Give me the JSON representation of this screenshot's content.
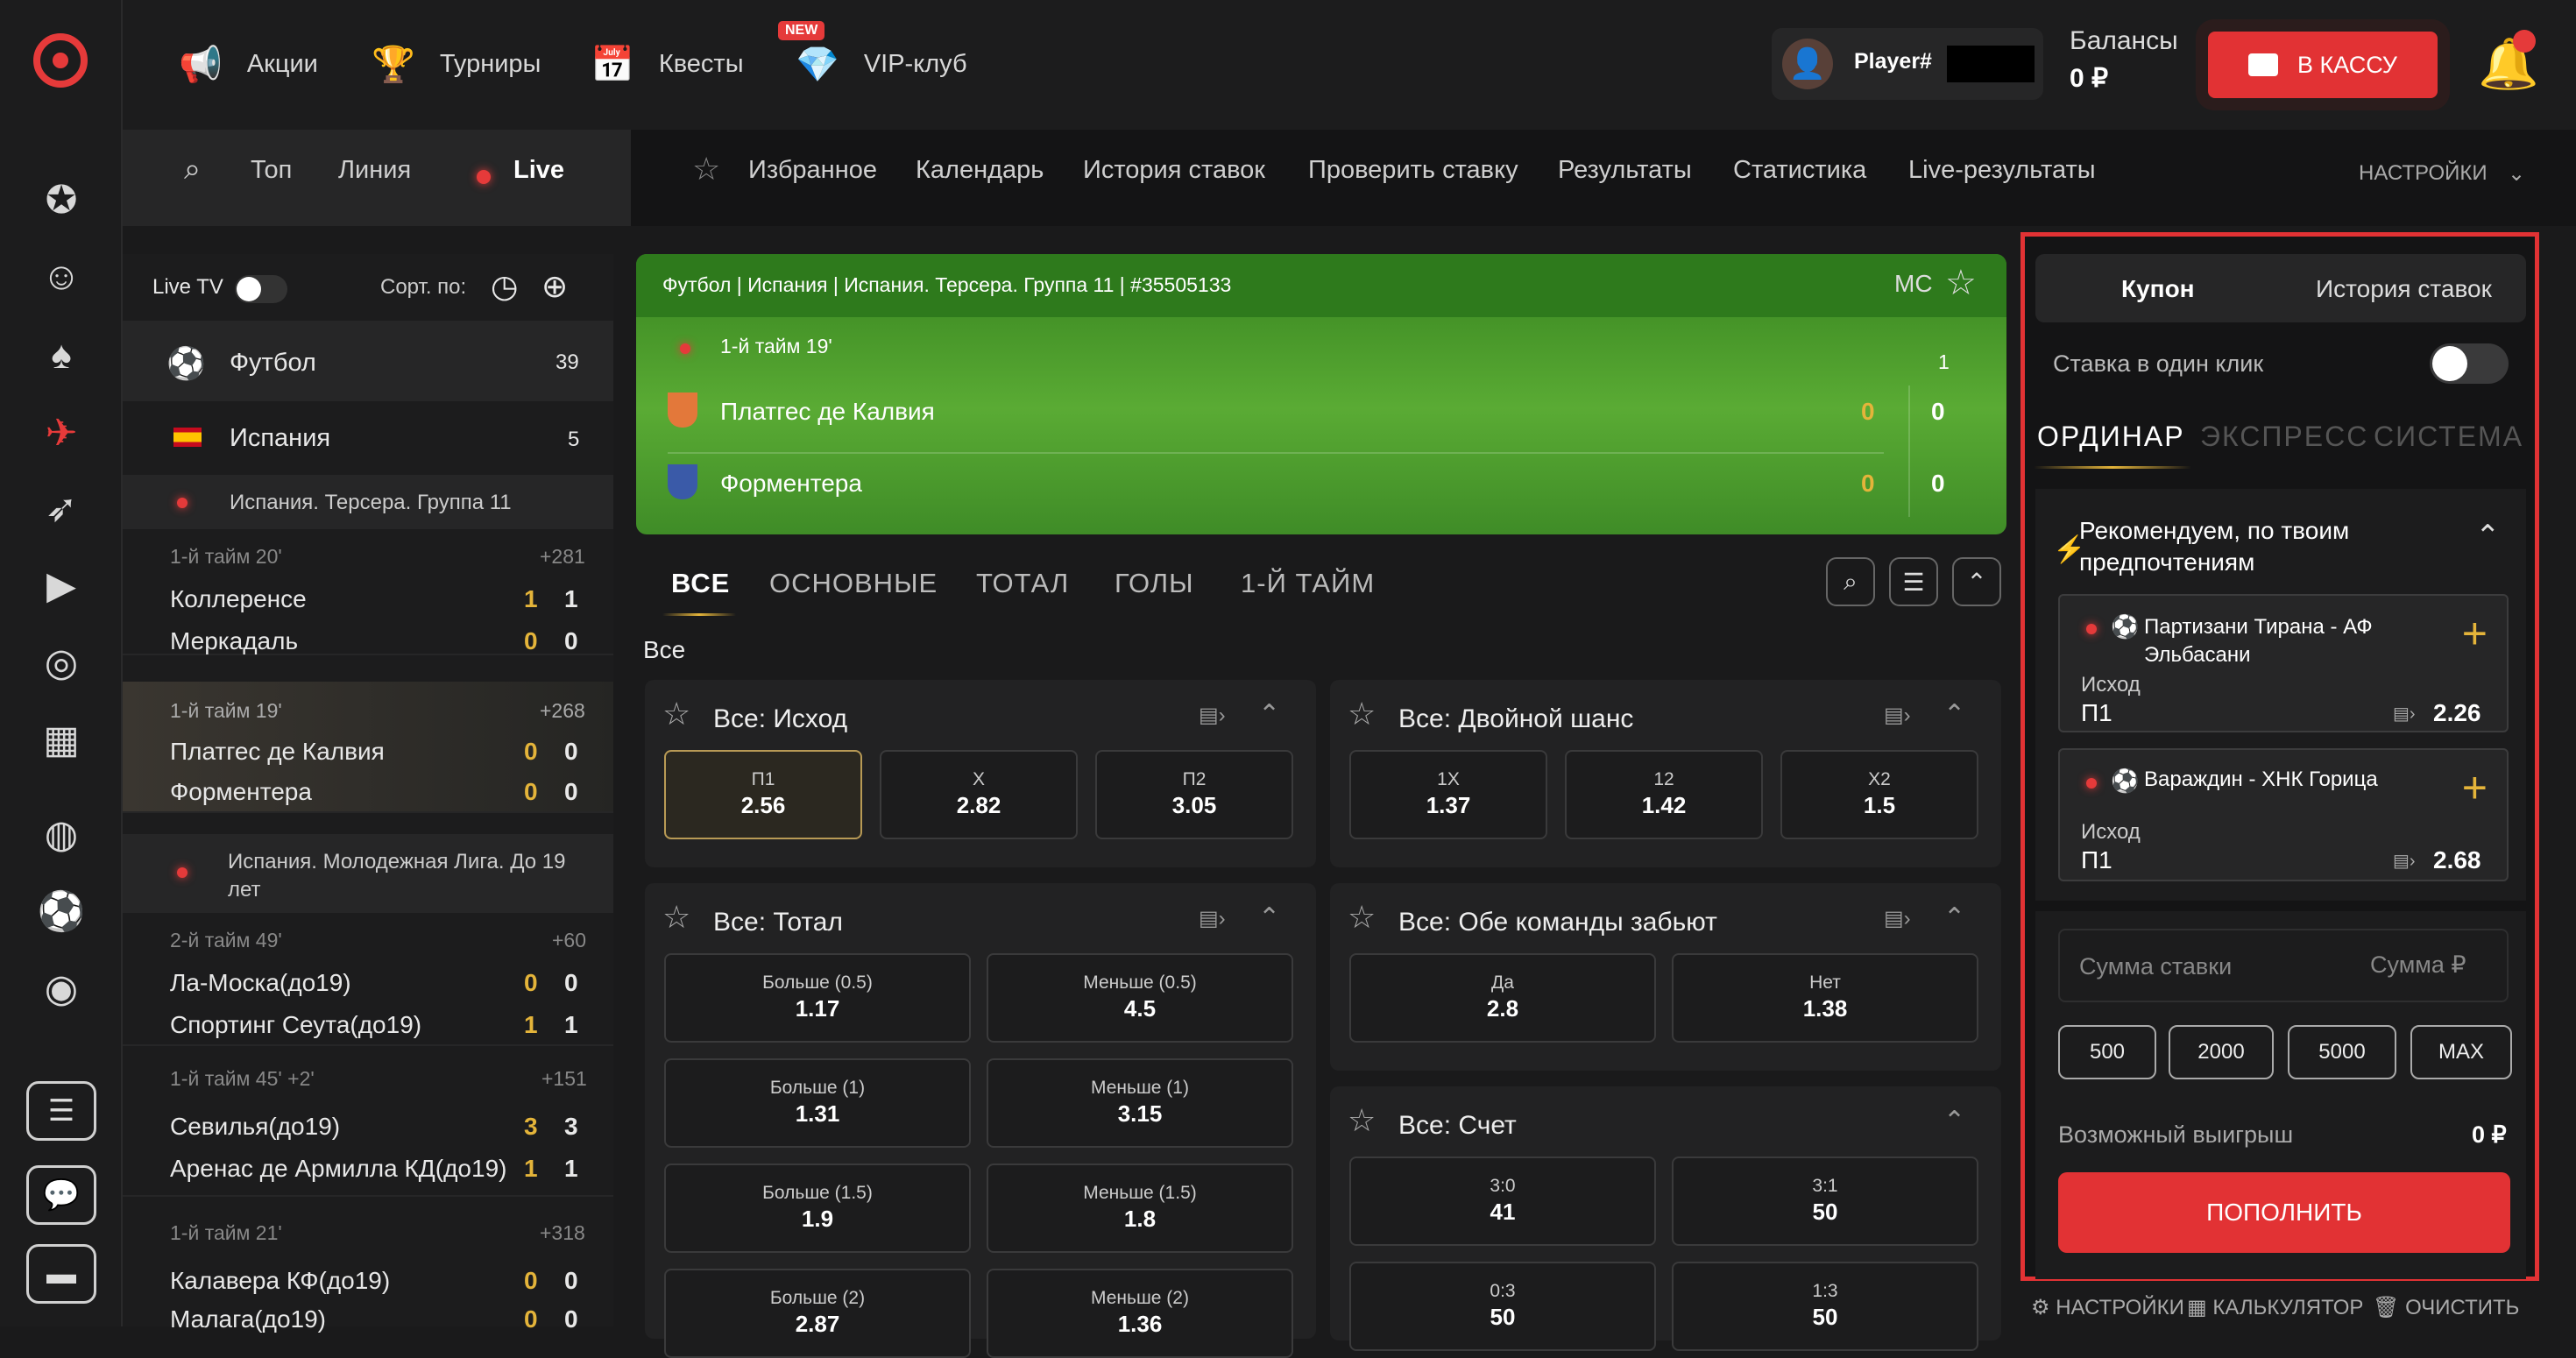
{
  "topnav": {
    "promos": "Акции",
    "tournaments": "Турниры",
    "quests": "Квесты",
    "quests_badge": "NEW",
    "vip": "VIP-клуб"
  },
  "user": {
    "name": "Player#",
    "balance_label": "Балансы",
    "balance": "0 ₽",
    "cashier": "В КАССУ"
  },
  "modes": {
    "top": "Топ",
    "line": "Линия",
    "live": "Live"
  },
  "subnav": {
    "favorites": "Избранное",
    "calendar": "Календарь",
    "history": "История ставок",
    "check": "Проверить ставку",
    "results": "Результаты",
    "stats": "Статистика",
    "live_results": "Live-результаты",
    "settings": "НАСТРОЙКИ"
  },
  "sidebar": {
    "livetv": "Live TV",
    "sort": "Сорт. по:",
    "sport": {
      "name": "Футбол",
      "count": "39"
    },
    "country": {
      "name": "Испания",
      "count": "5"
    },
    "league1": "Испания. Терсера. Группа 11",
    "league2": "Испания. Молодежная Лига. До 19 лет",
    "matches": [
      {
        "time": "1-й тайм 20'",
        "more": "+281",
        "t1": "Коллеренсе",
        "t2": "Меркадаль",
        "s1a": "1",
        "s1b": "1",
        "s2a": "0",
        "s2b": "0"
      },
      {
        "time": "1-й тайм 19'",
        "more": "+268",
        "t1": "Платгес де Калвия",
        "t2": "Форментера",
        "s1a": "0",
        "s1b": "0",
        "s2a": "0",
        "s2b": "0"
      },
      {
        "time": "2-й тайм 49'",
        "more": "+60",
        "t1": "Ла-Моска(до19)",
        "t2": "Спортинг Сеута(до19)",
        "s1a": "0",
        "s1b": "0",
        "s2a": "1",
        "s2b": "1"
      },
      {
        "time": "1-й тайм 45' +2'",
        "more": "+151",
        "t1": "Севилья(до19)",
        "t2": "Аренас де Армилла КД(до19)",
        "s1a": "3",
        "s1b": "3",
        "s2a": "1",
        "s2b": "1"
      },
      {
        "time": "1-й тайм 21'",
        "more": "+318",
        "t1": "Калавера КФ(до19)",
        "t2": "Малага(до19)",
        "s1a": "0",
        "s1b": "0",
        "s2a": "0",
        "s2b": "0"
      }
    ]
  },
  "event": {
    "breadcrumb": "Футбол | Испания | Испания. Терсера. Группа 11 | #35505133",
    "mc": "МС",
    "period": "1-й тайм 19'",
    "period_col": "1",
    "team1": "Платгес де Калвия",
    "team2": "Форментера",
    "t1_p": "0",
    "t1_tot": "0",
    "t2_p": "0",
    "t2_tot": "0"
  },
  "market_tabs": [
    "ВСЕ",
    "ОСНОВНЫЕ",
    "ТОТАЛ",
    "ГОЛЫ",
    "1-Й ТАЙМ"
  ],
  "section_label": "Все",
  "markets": {
    "outcome": {
      "title": "Все: Исход",
      "odds": [
        {
          "l": "П1",
          "v": "2.56"
        },
        {
          "l": "X",
          "v": "2.82"
        },
        {
          "l": "П2",
          "v": "3.05"
        }
      ]
    },
    "double": {
      "title": "Все: Двойной шанс",
      "odds": [
        {
          "l": "1X",
          "v": "1.37"
        },
        {
          "l": "12",
          "v": "1.42"
        },
        {
          "l": "X2",
          "v": "1.5"
        }
      ]
    },
    "total": {
      "title": "Все: Тотал",
      "odds": [
        {
          "l": "Больше (0.5)",
          "v": "1.17"
        },
        {
          "l": "Меньше (0.5)",
          "v": "4.5"
        },
        {
          "l": "Больше (1)",
          "v": "1.31"
        },
        {
          "l": "Меньше (1)",
          "v": "3.15"
        },
        {
          "l": "Больше (1.5)",
          "v": "1.9"
        },
        {
          "l": "Меньше (1.5)",
          "v": "1.8"
        },
        {
          "l": "Больше (2)",
          "v": "2.87"
        },
        {
          "l": "Меньше (2)",
          "v": "1.36"
        }
      ]
    },
    "btts": {
      "title": "Все: Обе команды забьют",
      "odds": [
        {
          "l": "Да",
          "v": "2.8"
        },
        {
          "l": "Нет",
          "v": "1.38"
        }
      ]
    },
    "score": {
      "title": "Все: Счет",
      "odds": [
        {
          "l": "3:0",
          "v": "41"
        },
        {
          "l": "3:1",
          "v": "50"
        },
        {
          "l": "0:3",
          "v": "50"
        },
        {
          "l": "1:3",
          "v": "50"
        }
      ]
    }
  },
  "coupon": {
    "tab_coupon": "Купон",
    "tab_history": "История ставок",
    "oneclick": "Ставка в один клик",
    "types": [
      "ОРДИНАР",
      "ЭКСПРЕСС",
      "СИСТЕМА"
    ],
    "rec_title": "Рекомендуем, по твоим предпочтениям",
    "recs": [
      {
        "match": "Партизани Тирана - АФ Эльбасани",
        "market": "Исход",
        "pick": "П1",
        "odd": "2.26"
      },
      {
        "match": "Вараждин - ХНК Горица",
        "market": "Исход",
        "pick": "П1",
        "odd": "2.68"
      }
    ],
    "stake_placeholder": "Сумма ставки",
    "stake_hint": "Сумма ₽",
    "chips": [
      "500",
      "2000",
      "5000",
      "MAX"
    ],
    "win_label": "Возможный выигрыш",
    "win_value": "0 ₽",
    "deposit": "ПОПОЛНИТЬ",
    "footer": {
      "settings": "НАСТРОЙКИ",
      "calc": "КАЛЬКУЛЯТОР",
      "clear": "ОЧИСТИТЬ"
    }
  },
  "colors": {
    "accent": "#e23234",
    "live_green": "#4a9a2c",
    "gold": "#e4b43a"
  }
}
